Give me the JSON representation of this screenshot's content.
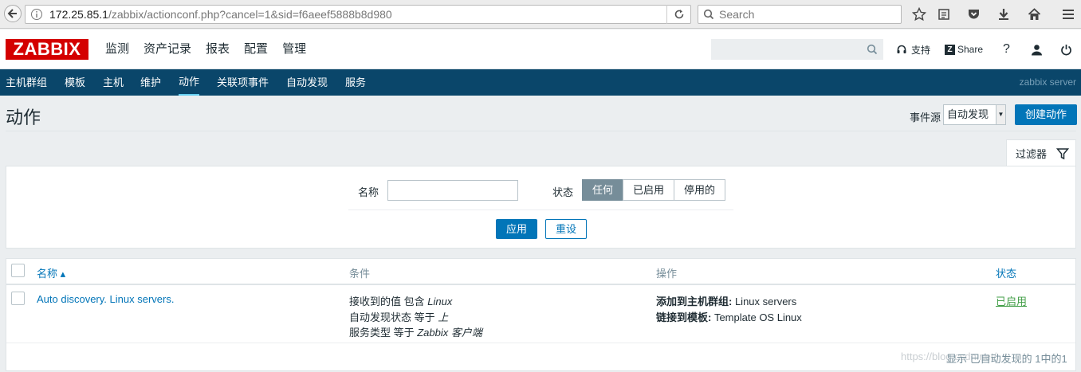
{
  "browser": {
    "url_host": "172.25.85.1",
    "url_path": "/zabbix/actionconf.php?cancel=1&sid=f6aeef5888b8d980",
    "search_placeholder": "Search"
  },
  "header": {
    "logo": "ZABBIX",
    "menu": [
      "监测",
      "资产记录",
      "报表",
      "配置",
      "管理"
    ],
    "support": "支持",
    "share": "Share",
    "help": "?"
  },
  "subnav": {
    "items": [
      "主机群组",
      "模板",
      "主机",
      "维护",
      "动作",
      "关联项事件",
      "自动发现",
      "服务"
    ],
    "active": "动作",
    "server": "zabbix server"
  },
  "page": {
    "title": "动作",
    "source_label": "事件源",
    "source_value": "自动发现",
    "create_button": "创建动作"
  },
  "filter": {
    "tab_label": "过滤器",
    "name_label": "名称",
    "name_value": "",
    "status_label": "状态",
    "status_options": [
      "任何",
      "已启用",
      "停用的"
    ],
    "status_selected": "任何",
    "apply": "应用",
    "reset": "重设"
  },
  "table": {
    "headers": {
      "name": "名称 ▴",
      "conditions": "条件",
      "operations": "操作",
      "status": "状态"
    },
    "rows": [
      {
        "name": "Auto discovery. Linux servers.",
        "conditions": [
          {
            "text": "接收到的值 包含 ",
            "value": "Linux"
          },
          {
            "text": "自动发现状态 等于 ",
            "value": "上"
          },
          {
            "text": "服务类型 等于 ",
            "value": "Zabbix 客户端"
          }
        ],
        "operations": [
          {
            "label": "添加到主机群组:",
            "value": " Linux servers"
          },
          {
            "label": "链接到模板:",
            "value": " Template OS Linux"
          }
        ],
        "status": "已启用"
      }
    ],
    "footer": "显示 已自动发现的 1中的1",
    "watermark": "https://blog.csdn.net/"
  }
}
